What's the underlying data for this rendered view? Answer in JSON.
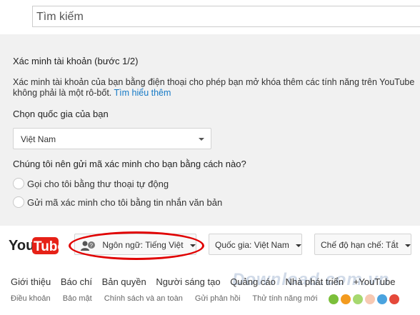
{
  "search": {
    "placeholder": "Tìm kiếm"
  },
  "verify": {
    "title": "Xác minh tài khoản (bước 1/2)",
    "description": "Xác minh tài khoản của bạn bằng điện thoại cho phép bạn mở khóa thêm các tính năng trên YouTube",
    "description_line2": "không phải là một rô-bốt.",
    "learn_more": "Tìm hiểu thêm",
    "country_label": "Chọn quốc gia của bạn",
    "country_value": "Việt Nam",
    "method_label": "Chúng tôi nên gửi mã xác minh cho bạn bằng cách nào?",
    "options": [
      "Gọi cho tôi bằng thư thoại tự động",
      "Gửi mã xác minh cho tôi bằng tin nhắn văn bản"
    ]
  },
  "footer": {
    "logo_text": {
      "you": "You",
      "tube": "Tube"
    },
    "language_btn": "Ngôn ngữ: Tiếng Việt",
    "country_btn": "Quốc gia: Việt Nam",
    "restricted_btn": "Chế độ hạn chế: Tắt",
    "links_primary": [
      "Giới thiệu",
      "Báo chí",
      "Bản quyền",
      "Người sáng tạo",
      "Quảng cáo",
      "Nhà phát triển",
      "+YouTube"
    ],
    "links_secondary": [
      "Điều khoản",
      "Bảo mật",
      "Chính sách và an toàn",
      "Gửi phản hồi",
      "Thử tính năng mới"
    ],
    "watermark": "Download.com.vn",
    "dot_colors": [
      "#7bbf3a",
      "#f39b1f",
      "#a6d86f",
      "#f7c9b3",
      "#4aa3df",
      "#e5493a"
    ]
  }
}
